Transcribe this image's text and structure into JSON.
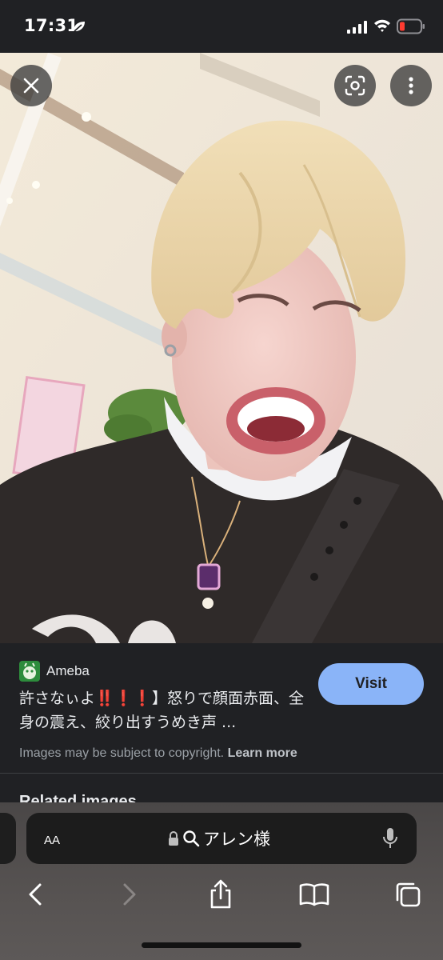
{
  "status_bar": {
    "time": "17:31",
    "battery_color": "#ff3b30"
  },
  "viewer": {
    "close_icon": "close-icon",
    "lens_icon": "google-lens-icon",
    "more_icon": "more-vert-icon"
  },
  "result": {
    "source_name": "Ameba",
    "title_line1": "許さなぃよ‼️❗️❗️】怒りで顔面赤面、全",
    "title_line2": "身の震え、絞り出すうめき声 ...",
    "visit_label": "Visit",
    "copyright_text": "Images may be subject to copyright.",
    "learn_more_label": "Learn more",
    "related_heading": "Related images"
  },
  "browser": {
    "text_size_label": "AA",
    "address_text": "アレン様",
    "accent_color": "#8ab4f8"
  }
}
